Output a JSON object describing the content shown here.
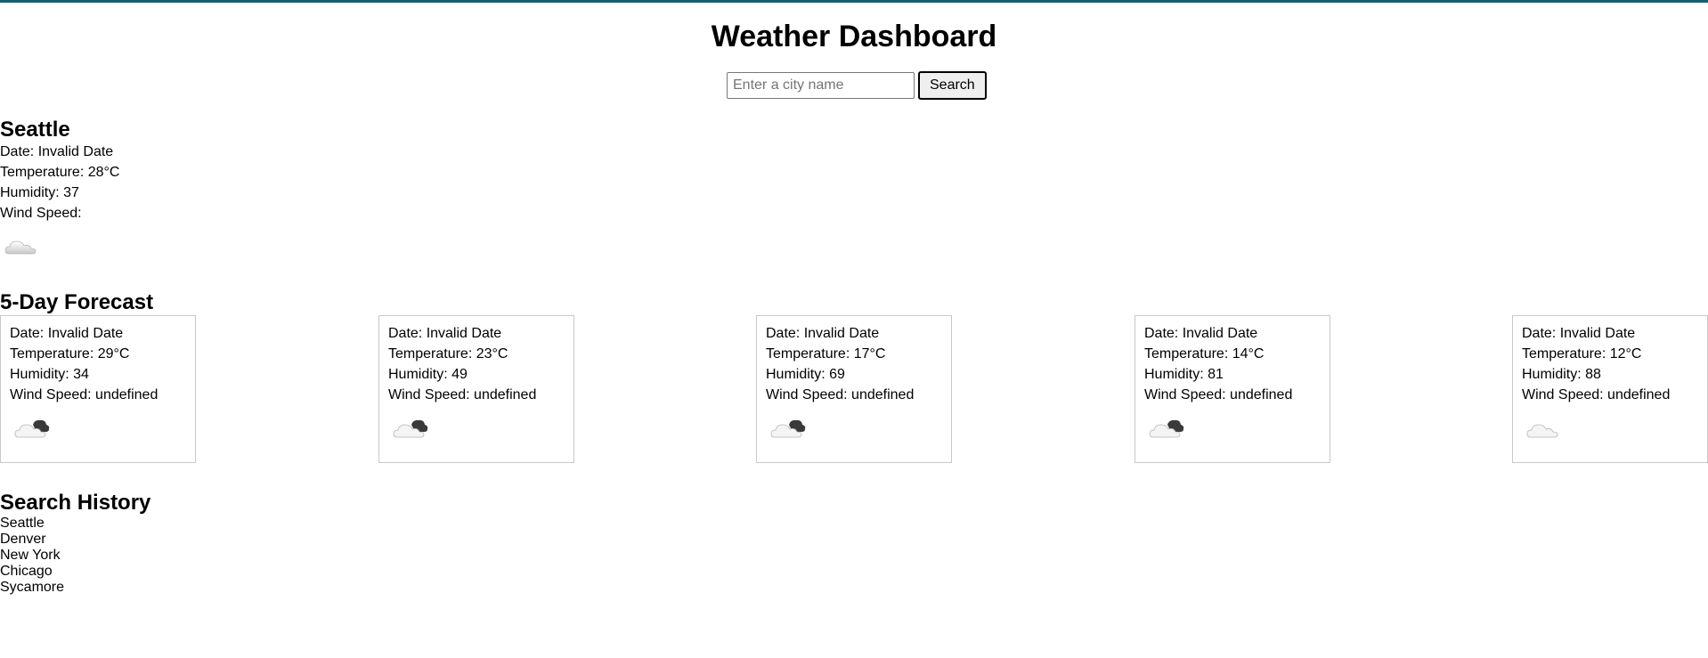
{
  "header": {
    "title": "Weather Dashboard"
  },
  "search": {
    "placeholder": "Enter a city name",
    "value": "",
    "button_label": "Search"
  },
  "current": {
    "city": "Seattle",
    "date": "Date: Invalid Date",
    "temperature": "Temperature: 28°C",
    "humidity": "Humidity: 37",
    "wind": "Wind Speed:",
    "icon": "cloud-icon"
  },
  "forecast": {
    "title": "5-Day Forecast",
    "days": [
      {
        "date": "Date: Invalid Date",
        "temperature": "Temperature: 29°C",
        "humidity": "Humidity: 34",
        "wind": "Wind Speed: undefined",
        "icon": "partly-cloudy-dark-icon"
      },
      {
        "date": "Date: Invalid Date",
        "temperature": "Temperature: 23°C",
        "humidity": "Humidity: 49",
        "wind": "Wind Speed: undefined",
        "icon": "partly-cloudy-dark-icon"
      },
      {
        "date": "Date: Invalid Date",
        "temperature": "Temperature: 17°C",
        "humidity": "Humidity: 69",
        "wind": "Wind Speed: undefined",
        "icon": "partly-cloudy-dark-icon"
      },
      {
        "date": "Date: Invalid Date",
        "temperature": "Temperature: 14°C",
        "humidity": "Humidity: 81",
        "wind": "Wind Speed: undefined",
        "icon": "partly-cloudy-dark-icon"
      },
      {
        "date": "Date: Invalid Date",
        "temperature": "Temperature: 12°C",
        "humidity": "Humidity: 88",
        "wind": "Wind Speed: undefined",
        "icon": "cloud-icon"
      }
    ]
  },
  "history": {
    "title": "Search History",
    "items": [
      "Seattle",
      "Denver",
      "New York",
      "Chicago",
      "Sycamore"
    ]
  },
  "colors": {
    "top_bar": "#14606a",
    "card_border": "#c8c8c8"
  }
}
